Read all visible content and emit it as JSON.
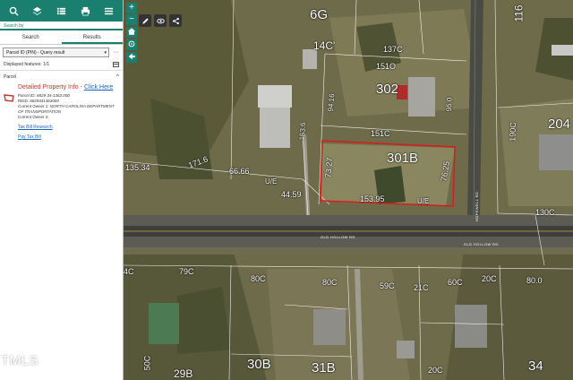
{
  "toolbar": {
    "icons": [
      "search-icon",
      "layers-icon",
      "list-icon",
      "print-icon",
      "menu-icon"
    ],
    "color": "#1a7f6e"
  },
  "search_by": "Search by",
  "tabs": {
    "search": "Search",
    "results": "Results"
  },
  "result_select": {
    "value": "Parcel ID (PIN) - Query result"
  },
  "displayed_features": "Displayed features: 1/1",
  "parcel": {
    "section_label": "Parcel",
    "title": "Detailed Property Info - ",
    "title_link": "Click Here",
    "parcel_id_label": "Parcel ID:",
    "parcel_id": "6829-34-1363.000",
    "reid_label": "REID:",
    "reid": "6829341363000",
    "owner1_label": "Current Owner 1:",
    "owner1": "NORTH CAROLINA DEPARTMENT OF TRANSPORTATION",
    "owner2_label": "Current Owner 2:",
    "owner2": "",
    "tax_bill_link": "Tax Bill Research",
    "pay_tax_link": "Pay Tax Bill"
  },
  "watermark": "TMLS",
  "map": {
    "zoom_in": "+",
    "zoom_out": "−",
    "parcel_labels": {
      "l_6g": "6G",
      "l_116": "116",
      "l_14c": "14C'",
      "l_137c": "137C",
      "l_151o": "151O",
      "l_302": "302",
      "l_9416": "94.16",
      "l_950": "95.0",
      "l_151c": "151C",
      "l_204": "204",
      "l_190c": "190C",
      "l_301b": "301B",
      "l_1536": "153.6",
      "l_13534": "135.34",
      "l_1716": "171.6",
      "l_6666": "66.66",
      "l_ue1": "U/E",
      "l_4459": "44.59",
      "l_7327": "73.27",
      "l_7625": "76.25",
      "l_15395": "153.95",
      "l_ue2": "U/E",
      "l_130c": "130C",
      "l_79c": "79C",
      "l_80c": "80C",
      "l_80c2": "80C",
      "l_59c": "59C",
      "l_21c": "21C",
      "l_60c": "60C",
      "l_20c": "20C",
      "l_80": "80.0",
      "l_30b": "30B",
      "l_31b": "31B",
      "l_29b": "29B",
      "l_34": "34",
      "l_50c": "50C",
      "l_20c2": "20C",
      "l_4c": "4C"
    },
    "road_labels": {
      "main_road": "OLD HOLLOW RD",
      "main_road_2": "OLD HOLLOW RD",
      "side_road": "HOPEWELL RD"
    },
    "highlight_color": "#d81b1b"
  }
}
